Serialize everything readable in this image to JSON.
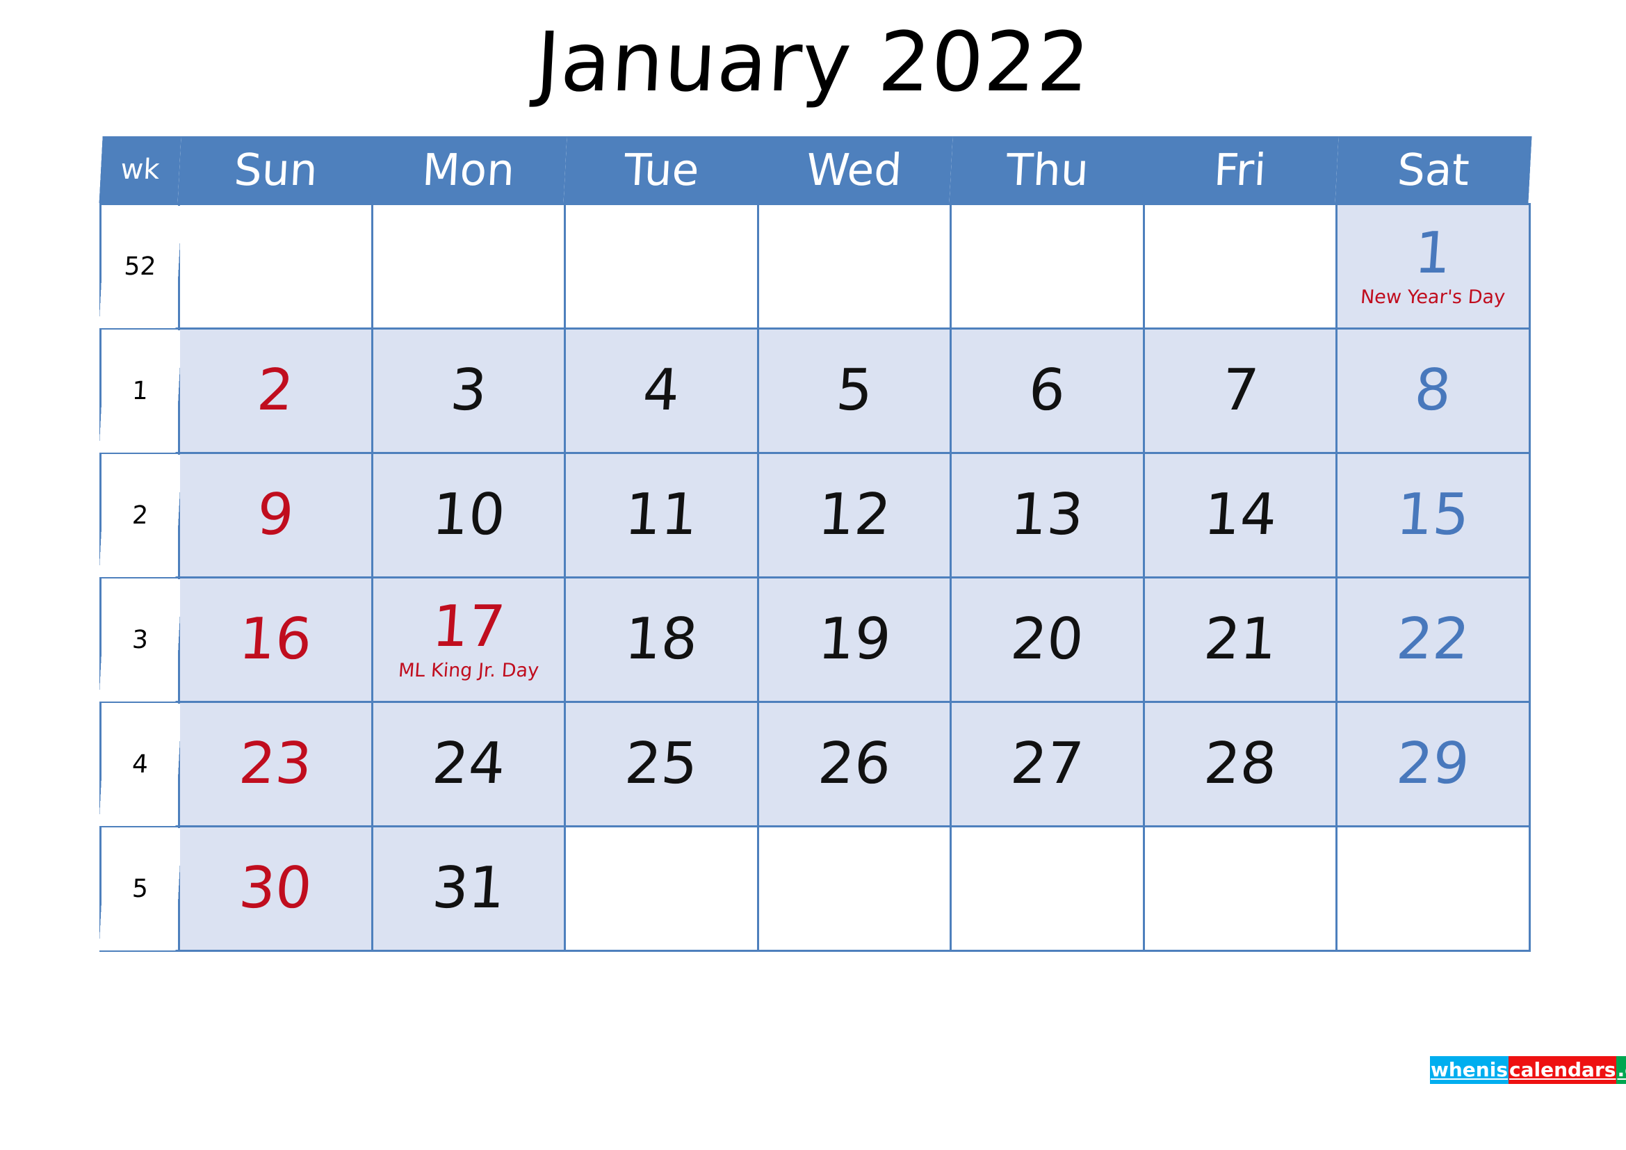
{
  "title": "January 2022",
  "colors": {
    "header_blue": "#4e80bd",
    "cell_fill": "#dbe2f2",
    "sunday_red": "#c00d1e",
    "saturday_blue": "#4878bc",
    "weekday_black": "#111111",
    "grid_line": "#4e80bd"
  },
  "header": {
    "week_label": "wk",
    "days": [
      "Sun",
      "Mon",
      "Tue",
      "Wed",
      "Thu",
      "Fri",
      "Sat"
    ]
  },
  "weeks": [
    {
      "wk": "52",
      "days": [
        {
          "num": "",
          "kind": "empty",
          "holiday": ""
        },
        {
          "num": "",
          "kind": "empty",
          "holiday": ""
        },
        {
          "num": "",
          "kind": "empty",
          "holiday": ""
        },
        {
          "num": "",
          "kind": "empty",
          "holiday": ""
        },
        {
          "num": "",
          "kind": "empty",
          "holiday": ""
        },
        {
          "num": "",
          "kind": "empty",
          "holiday": ""
        },
        {
          "num": "1",
          "kind": "saturday",
          "holiday": "New Year's Day"
        }
      ]
    },
    {
      "wk": "1",
      "days": [
        {
          "num": "2",
          "kind": "sunday",
          "holiday": ""
        },
        {
          "num": "3",
          "kind": "weekday",
          "holiday": ""
        },
        {
          "num": "4",
          "kind": "weekday",
          "holiday": ""
        },
        {
          "num": "5",
          "kind": "weekday",
          "holiday": ""
        },
        {
          "num": "6",
          "kind": "weekday",
          "holiday": ""
        },
        {
          "num": "7",
          "kind": "weekday",
          "holiday": ""
        },
        {
          "num": "8",
          "kind": "saturday",
          "holiday": ""
        }
      ]
    },
    {
      "wk": "2",
      "days": [
        {
          "num": "9",
          "kind": "sunday",
          "holiday": ""
        },
        {
          "num": "10",
          "kind": "weekday",
          "holiday": ""
        },
        {
          "num": "11",
          "kind": "weekday",
          "holiday": ""
        },
        {
          "num": "12",
          "kind": "weekday",
          "holiday": ""
        },
        {
          "num": "13",
          "kind": "weekday",
          "holiday": ""
        },
        {
          "num": "14",
          "kind": "weekday",
          "holiday": ""
        },
        {
          "num": "15",
          "kind": "saturday",
          "holiday": ""
        }
      ]
    },
    {
      "wk": "3",
      "days": [
        {
          "num": "16",
          "kind": "sunday",
          "holiday": ""
        },
        {
          "num": "17",
          "kind": "sunday",
          "holiday": "ML King Jr. Day"
        },
        {
          "num": "18",
          "kind": "weekday",
          "holiday": ""
        },
        {
          "num": "19",
          "kind": "weekday",
          "holiday": ""
        },
        {
          "num": "20",
          "kind": "weekday",
          "holiday": ""
        },
        {
          "num": "21",
          "kind": "weekday",
          "holiday": ""
        },
        {
          "num": "22",
          "kind": "saturday",
          "holiday": ""
        }
      ]
    },
    {
      "wk": "4",
      "days": [
        {
          "num": "23",
          "kind": "sunday",
          "holiday": ""
        },
        {
          "num": "24",
          "kind": "weekday",
          "holiday": ""
        },
        {
          "num": "25",
          "kind": "weekday",
          "holiday": ""
        },
        {
          "num": "26",
          "kind": "weekday",
          "holiday": ""
        },
        {
          "num": "27",
          "kind": "weekday",
          "holiday": ""
        },
        {
          "num": "28",
          "kind": "weekday",
          "holiday": ""
        },
        {
          "num": "29",
          "kind": "saturday",
          "holiday": ""
        }
      ]
    },
    {
      "wk": "5",
      "days": [
        {
          "num": "30",
          "kind": "sunday",
          "holiday": ""
        },
        {
          "num": "31",
          "kind": "weekday",
          "holiday": ""
        },
        {
          "num": "",
          "kind": "empty",
          "holiday": ""
        },
        {
          "num": "",
          "kind": "empty",
          "holiday": ""
        },
        {
          "num": "",
          "kind": "empty",
          "holiday": ""
        },
        {
          "num": "",
          "kind": "empty",
          "holiday": ""
        },
        {
          "num": "",
          "kind": "empty",
          "holiday": ""
        }
      ]
    }
  ],
  "logo": {
    "part1": "whenis",
    "part2": "calendars",
    "part3": ".com"
  }
}
